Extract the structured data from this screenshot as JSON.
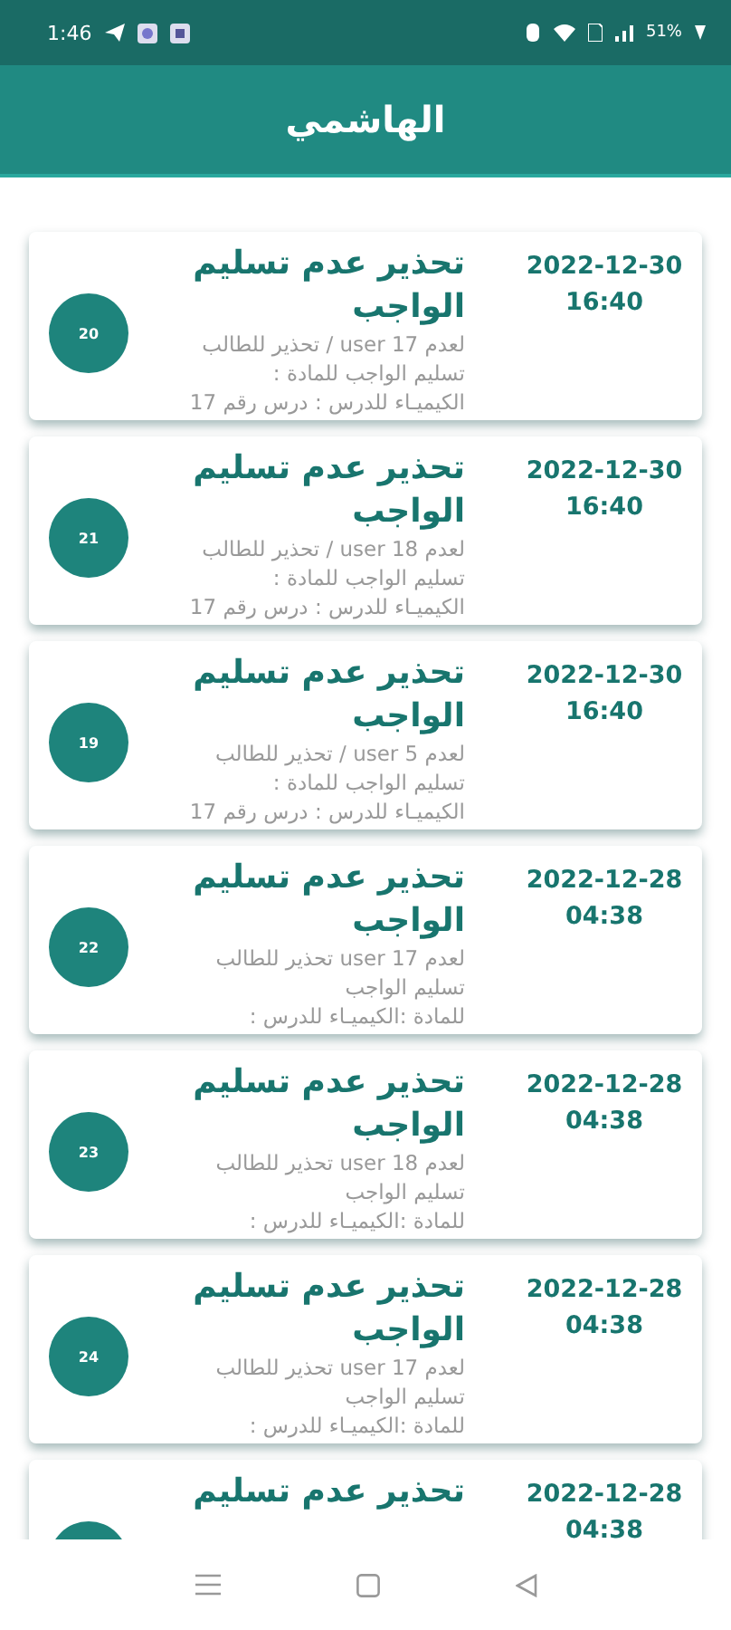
{
  "status_bar": {
    "time": "1:46",
    "battery": "51%"
  },
  "app_bar": {
    "title": "الهاشمي"
  },
  "notifications": [
    {
      "number": "20",
      "title": "تحذير عدم تسليم الواجب",
      "date": "2022-12-30",
      "time": "16:40",
      "body_lines": [
        "لعدم user 17 / تحذير للطالب",
        "تسليم الواجب للمادة :",
        "الكيميـاء للدرس : درس رقم 17"
      ]
    },
    {
      "number": "21",
      "title": "تحذير عدم تسليم الواجب",
      "date": "2022-12-30",
      "time": "16:40",
      "body_lines": [
        "لعدم user 18 / تحذير للطالب",
        "تسليم الواجب للمادة :",
        "الكيميـاء للدرس : درس رقم 17"
      ]
    },
    {
      "number": "19",
      "title": "تحذير عدم تسليم الواجب",
      "date": "2022-12-30",
      "time": "16:40",
      "body_lines": [
        "لعدم user 5 / تحذير للطالب",
        "تسليم الواجب للمادة :",
        "الكيميـاء للدرس : درس رقم 17"
      ]
    },
    {
      "number": "22",
      "title": "تحذير عدم تسليم الواجب",
      "date": "2022-12-28",
      "time": "04:38",
      "body_lines": [
        "لعدم user 17 تحذير للطالب",
        "تسليم الواجب",
        "للمادة :الكيميـاء للدرس :"
      ]
    },
    {
      "number": "23",
      "title": "تحذير عدم تسليم الواجب",
      "date": "2022-12-28",
      "time": "04:38",
      "body_lines": [
        "لعدم user 18 تحذير للطالب",
        "تسليم الواجب",
        "للمادة :الكيميـاء للدرس :"
      ]
    },
    {
      "number": "24",
      "title": "تحذير عدم تسليم الواجب",
      "date": "2022-12-28",
      "time": "04:38",
      "body_lines": [
        "لعدم user 17 تحذير للطالب",
        "تسليم الواجب",
        "للمادة :الكيميـاء للدرس :"
      ]
    },
    {
      "title": "تحذير عدم تسليم",
      "date": "2022-12-28",
      "time": "04:38"
    }
  ]
}
